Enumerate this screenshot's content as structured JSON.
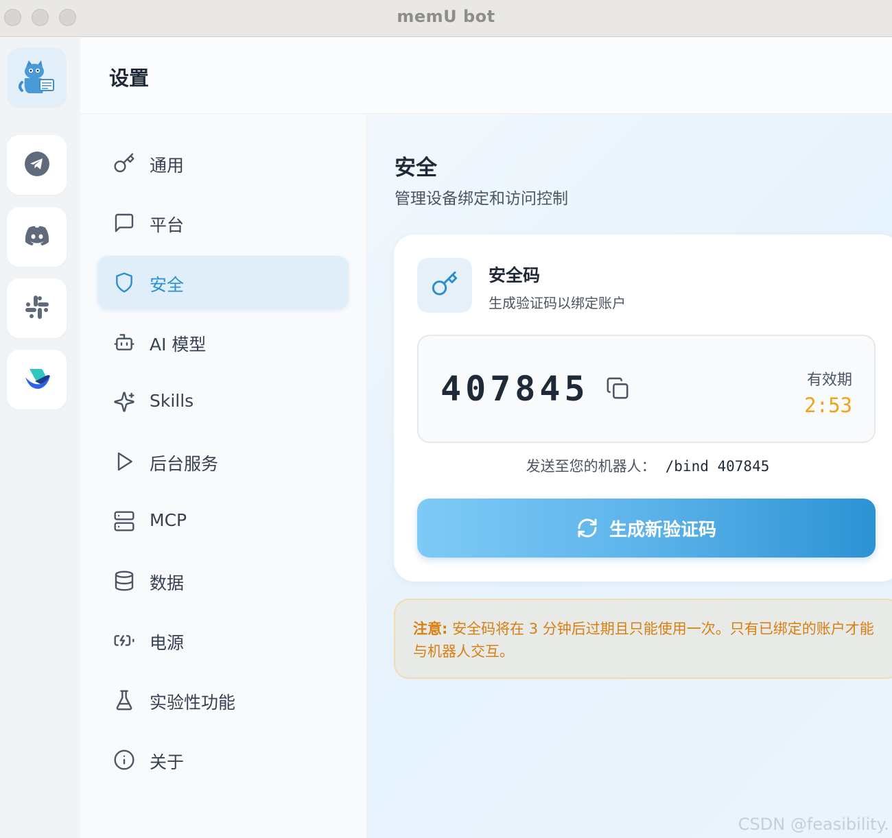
{
  "window": {
    "title": "memU bot"
  },
  "rail": {
    "items": [
      {
        "name": "memu-logo",
        "icon": "cat-mascot-icon"
      },
      {
        "name": "telegram",
        "icon": "telegram-icon"
      },
      {
        "name": "discord",
        "icon": "discord-icon"
      },
      {
        "name": "slack",
        "icon": "slack-icon"
      },
      {
        "name": "lark",
        "icon": "lark-icon"
      }
    ]
  },
  "header": {
    "title": "设置"
  },
  "nav": {
    "items": [
      {
        "label": "通用",
        "icon": "key-icon"
      },
      {
        "label": "平台",
        "icon": "message-square-icon"
      },
      {
        "label": "安全",
        "icon": "shield-icon",
        "active": true
      },
      {
        "label": "AI 模型",
        "icon": "bot-icon"
      },
      {
        "label": "Skills",
        "icon": "sparkles-icon"
      },
      {
        "label": "后台服务",
        "icon": "play-icon"
      },
      {
        "label": "MCP",
        "icon": "server-icon"
      },
      {
        "label": "数据",
        "icon": "database-icon"
      },
      {
        "label": "电源",
        "icon": "battery-charging-icon"
      },
      {
        "label": "实验性功能",
        "icon": "flask-icon"
      },
      {
        "label": "关于",
        "icon": "info-icon"
      }
    ]
  },
  "main": {
    "title": "安全",
    "subtitle": "管理设备绑定和访问控制",
    "card": {
      "title": "安全码",
      "subtitle": "生成验证码以绑定账户",
      "code": "407845",
      "valid_label": "有效期",
      "valid_time": "2:53",
      "hint_label": "发送至您的机器人：",
      "hint_command": "/bind 407845",
      "generate_label": "生成新验证码"
    },
    "note": {
      "prefix": "注意:",
      "text": " 安全码将在 3 分钟后过期且只能使用一次。只有已绑定的账户才能与机器人交互。"
    }
  },
  "colors": {
    "accent": "#2b8fd0",
    "timer": "#f0a318",
    "note_text": "#d97f10"
  },
  "watermark": "CSDN @feasibility."
}
